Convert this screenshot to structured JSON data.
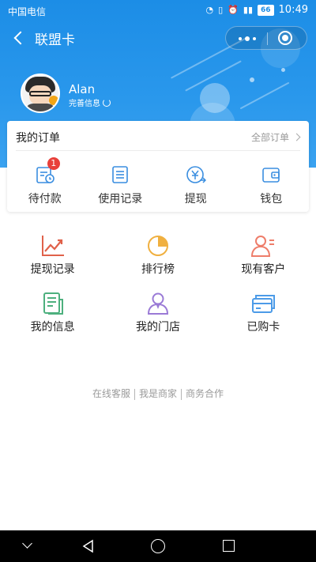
{
  "statusbar": {
    "carrier": "中国电信",
    "battery": "66",
    "time": "10:49"
  },
  "nav": {
    "title": "联盟卡"
  },
  "profile": {
    "username": "Alan",
    "perfect_info": "完善信息"
  },
  "orders": {
    "title": "我的订单",
    "all_label": "全部订单",
    "items": [
      {
        "label": "待付款",
        "badge": "1",
        "icon": "pending-payment-icon"
      },
      {
        "label": "使用记录",
        "icon": "usage-record-icon"
      },
      {
        "label": "提现",
        "icon": "withdraw-icon"
      },
      {
        "label": "钱包",
        "icon": "wallet-icon"
      }
    ]
  },
  "grid": {
    "items": [
      {
        "label": "提现记录",
        "icon": "withdraw-record-icon",
        "color": "#e0614a"
      },
      {
        "label": "排行榜",
        "icon": "ranking-icon",
        "color": "#f0b040"
      },
      {
        "label": "现有客户",
        "icon": "customers-icon",
        "color": "#ee7d6a"
      },
      {
        "label": "我的信息",
        "icon": "my-info-icon",
        "color": "#4db07e"
      },
      {
        "label": "我的门店",
        "icon": "my-store-icon",
        "color": "#9a7ad6"
      },
      {
        "label": "已购卡",
        "icon": "purchased-cards-icon",
        "color": "#4c9be8"
      }
    ]
  },
  "footer": {
    "links": [
      "在线客服",
      "我是商家",
      "商务合作"
    ]
  },
  "colors": {
    "primary": "#1c8de6",
    "icon_blue": "#3a8ee0",
    "badge_red": "#e8403a"
  }
}
